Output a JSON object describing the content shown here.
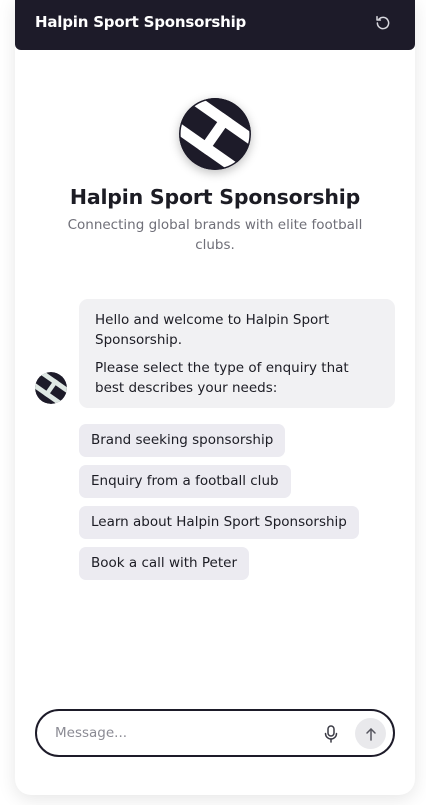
{
  "header": {
    "title": "Halpin Sport Sponsorship",
    "reset_icon": "refresh-icon"
  },
  "brand": {
    "logo_icon": "halpin-h-logo",
    "name": "Halpin Sport Sponsorship",
    "tagline": "Connecting global brands with elite football clubs."
  },
  "conversation": {
    "bot_avatar_icon": "halpin-h-logo",
    "messages": [
      "Hello and welcome to Halpin Sport Sponsorship.",
      "Please select the type of enquiry that best describes your needs:"
    ],
    "options": [
      "Brand seeking sponsorship",
      "Enquiry from a football club",
      "Learn about Halpin Sport Sponsorship",
      "Book a call with Peter"
    ]
  },
  "composer": {
    "placeholder": "Message...",
    "value": "",
    "mic_icon": "microphone-icon",
    "send_icon": "arrow-up-icon"
  },
  "colors": {
    "header_bg": "#1d1b29",
    "bubble_bg": "#f1f1f3",
    "option_bg": "#ecebf1",
    "logo_bg": "#ffffff",
    "logo_mark": "#1d1b29"
  }
}
